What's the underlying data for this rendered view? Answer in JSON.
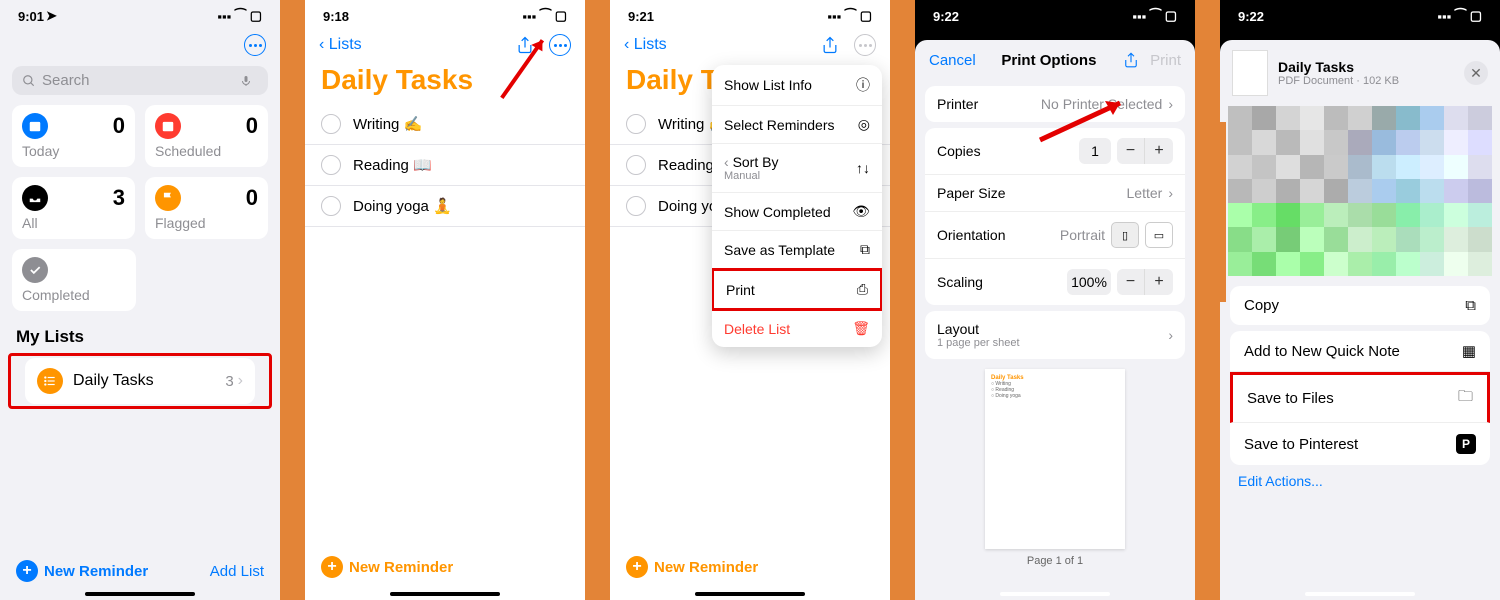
{
  "screen1": {
    "time": "9:01",
    "search_placeholder": "Search",
    "cards": {
      "today": {
        "label": "Today",
        "count": "0"
      },
      "scheduled": {
        "label": "Scheduled",
        "count": "0"
      },
      "all": {
        "label": "All",
        "count": "3"
      },
      "flagged": {
        "label": "Flagged",
        "count": "0"
      },
      "completed": {
        "label": "Completed"
      }
    },
    "my_lists_header": "My Lists",
    "list_name": "Daily Tasks",
    "list_count": "3",
    "new_reminder": "New Reminder",
    "add_list": "Add List"
  },
  "screen2": {
    "time": "9:18",
    "back": "Lists",
    "title": "Daily Tasks",
    "tasks": [
      "Writing ✍️",
      "Reading 📖",
      "Doing yoga 🧘"
    ],
    "new_reminder": "New Reminder"
  },
  "screen3": {
    "time": "9:21",
    "back": "Lists",
    "title": "Daily Tas",
    "tasks": [
      "Writing ✍️",
      "Reading 📖",
      "Doing yoga 🧘"
    ],
    "menu": {
      "show_info": "Show List Info",
      "select": "Select Reminders",
      "sort_by": "Sort By",
      "sort_by_sub": "Manual",
      "show_completed": "Show Completed",
      "save_template": "Save as Template",
      "print": "Print",
      "delete": "Delete List"
    },
    "new_reminder": "New Reminder"
  },
  "screen4": {
    "time": "9:22",
    "cancel": "Cancel",
    "title": "Print Options",
    "print": "Print",
    "printer_label": "Printer",
    "printer_value": "No Printer Selected",
    "copies_label": "Copies",
    "copies_value": "1",
    "paper_label": "Paper Size",
    "paper_value": "Letter",
    "orient_label": "Orientation",
    "orient_value": "Portrait",
    "scaling_label": "Scaling",
    "scaling_value": "100%",
    "layout_label": "Layout",
    "layout_sub": "1 page per sheet",
    "preview_title": "Daily Tasks",
    "preview_items": [
      "Writing",
      "Reading",
      "Doing yoga"
    ],
    "page_label": "Page 1 of 1"
  },
  "screen5": {
    "time": "9:22",
    "doc_title": "Daily Tasks",
    "doc_sub": "PDF Document · 102 KB",
    "copy": "Copy",
    "quick_note": "Add to New Quick Note",
    "save_files": "Save to Files",
    "pinterest": "Save to Pinterest",
    "edit_actions": "Edit Actions..."
  }
}
